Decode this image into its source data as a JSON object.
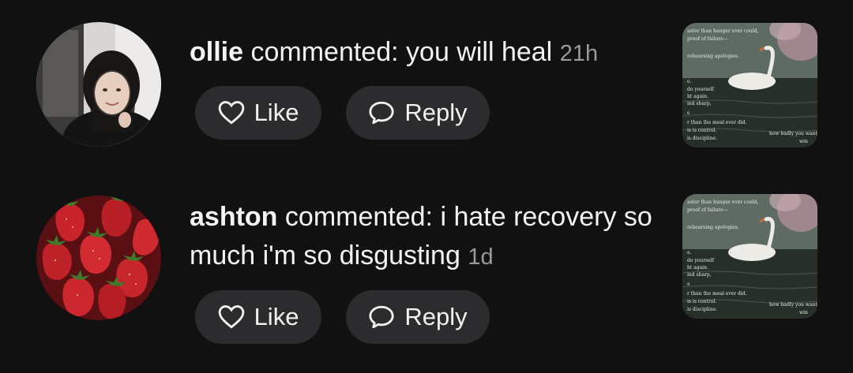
{
  "notifications": [
    {
      "user": "ollie",
      "action": "commented:",
      "comment": "you will heal",
      "time": "21h",
      "avatar": "girl-avatar",
      "like_label": "Like",
      "reply_label": "Reply",
      "post_thumb": "swan-poem-thumbnail"
    },
    {
      "user": "ashton",
      "action": "commented:",
      "comment": "i hate recovery so much i'm so disgusting",
      "time": "1d",
      "avatar": "strawberries-avatar",
      "like_label": "Like",
      "reply_label": "Reply",
      "post_thumb": "swan-poem-thumbnail"
    }
  ],
  "colors": {
    "background": "#111112",
    "button_bg": "#2c2c2e",
    "text": "#f4f4f4",
    "timestamp": "#9a9a9a"
  }
}
